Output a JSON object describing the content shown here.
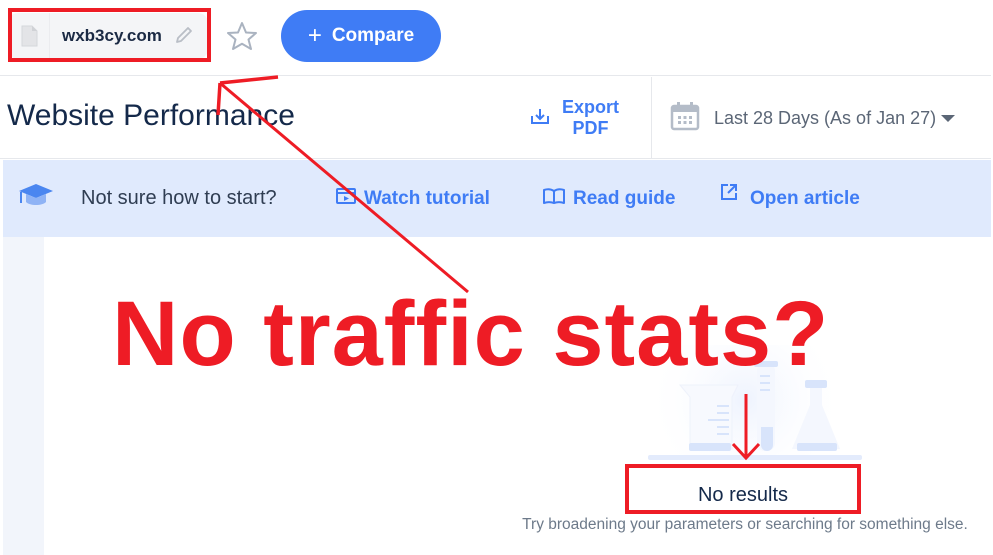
{
  "topbar": {
    "domain": "wxb3cy.com",
    "compare_label": "Compare",
    "icons": {
      "file": "file-icon",
      "edit": "pencil-icon",
      "favorite": "star-icon",
      "add": "plus-icon"
    }
  },
  "header": {
    "title": "Website Performance",
    "export_line1": "Export",
    "export_line2": "PDF",
    "date_range": "Last 28 Days (As of Jan 27)",
    "icons": {
      "export": "download-icon",
      "calendar": "calendar-icon",
      "dropdown": "caret-down-icon"
    }
  },
  "helpbar": {
    "question": "Not sure how to start?",
    "links": [
      {
        "label": "Watch tutorial",
        "icon": "video-icon"
      },
      {
        "label": "Read guide",
        "icon": "book-icon"
      },
      {
        "label": "Open article",
        "icon": "external-link-icon"
      }
    ],
    "icon": "graduation-cap-icon"
  },
  "empty_state": {
    "title": "No results",
    "subtitle": "Try broadening your parameters or searching for something else.",
    "illustration": "lab-beakers-illustration"
  },
  "annotations": {
    "headline": "No traffic stats?",
    "color": "#ee1c25"
  },
  "colors": {
    "accent": "#3f7cf5",
    "helpbar_bg": "#e0eafd",
    "title_text": "#14294a"
  }
}
